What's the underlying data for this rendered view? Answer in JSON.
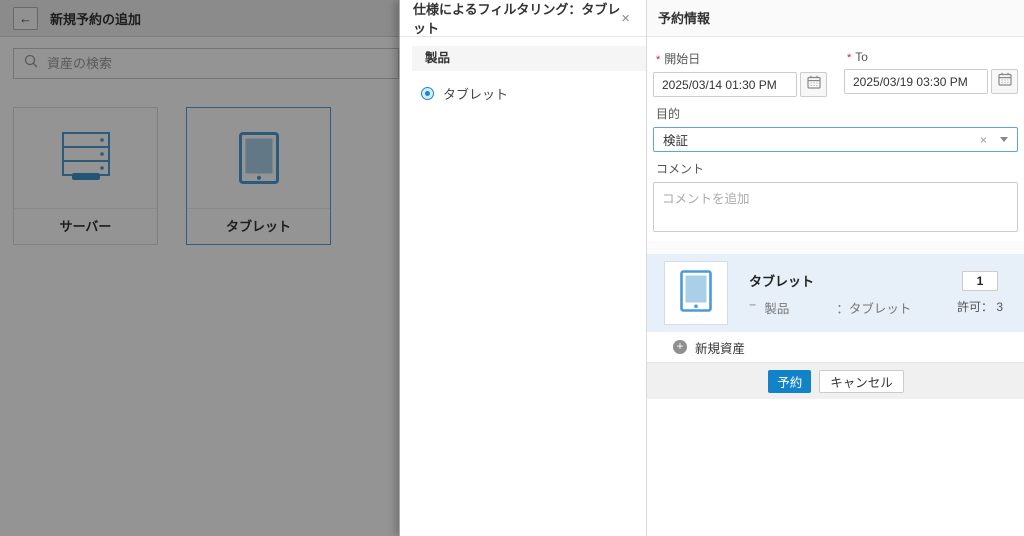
{
  "colors": {
    "primary_blue": "#1183c6",
    "icon_blue": "#4a9bd5",
    "asset_row_bg": "#e7eff9",
    "focus_border": "#5aa7dd",
    "required_red": "#e02020"
  },
  "icons": {
    "back": "←",
    "close": "×",
    "clear": "×",
    "plus": "+"
  },
  "left_panel": {
    "title": "新規予約の追加",
    "search_placeholder": "資産の検索",
    "cards": [
      {
        "label": "サーバー"
      },
      {
        "label": "タブレット"
      }
    ]
  },
  "filter_panel": {
    "title": "仕様によるフィルタリング：タブレット",
    "section_header": "製品",
    "option_label": "タブレット"
  },
  "reservation": {
    "title": "予約情報",
    "required_marker": "*",
    "start": {
      "label": "開始日",
      "value": "2025/03/14 01:30 PM"
    },
    "end": {
      "label": "To",
      "value": "2025/03/19 03:30 PM"
    },
    "purpose": {
      "label": "目的",
      "value": "検証"
    },
    "comment": {
      "label": "コメント",
      "placeholder": "コメントを追加"
    },
    "asset": {
      "title": "タブレット",
      "spec_prefix": "−",
      "spec_key": "製品",
      "spec_value": "：タブレット",
      "quantity": "1",
      "allowed": "許可： 3"
    },
    "add_asset": "新規資産",
    "buttons": {
      "reserve": "予約",
      "cancel": "キャンセル"
    }
  }
}
